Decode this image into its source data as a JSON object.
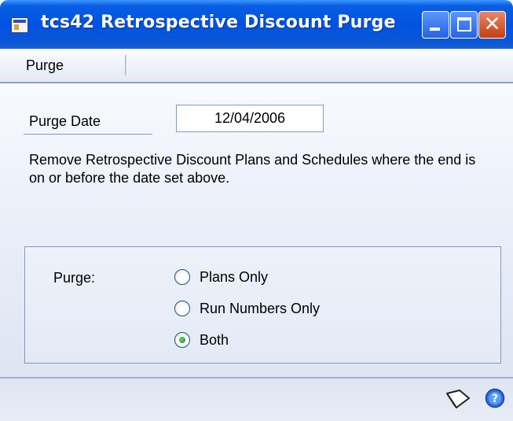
{
  "window": {
    "title": "tcs42 Retrospective Discount Purge"
  },
  "menu": {
    "items": [
      "Purge"
    ]
  },
  "form": {
    "purge_date_label": "Purge Date",
    "purge_date_value": "12/04/2006",
    "description": "Remove Retrospective Discount Plans and Schedules where the end is on or before the date set above.",
    "purge_group_label": "Purge:",
    "options": [
      {
        "label": "Plans Only",
        "selected": false
      },
      {
        "label": "Run Numbers Only",
        "selected": false
      },
      {
        "label": "Both",
        "selected": true
      }
    ]
  },
  "icons": {
    "app": "app-window-icon",
    "minimize": "minimize-icon",
    "maximize": "maximize-icon",
    "close": "close-icon",
    "note": "note-icon",
    "help": "help-icon"
  },
  "colors": {
    "titlebar": "#0053e0",
    "close_button": "#c33e10",
    "selected_radio": "#1b8a1b"
  }
}
